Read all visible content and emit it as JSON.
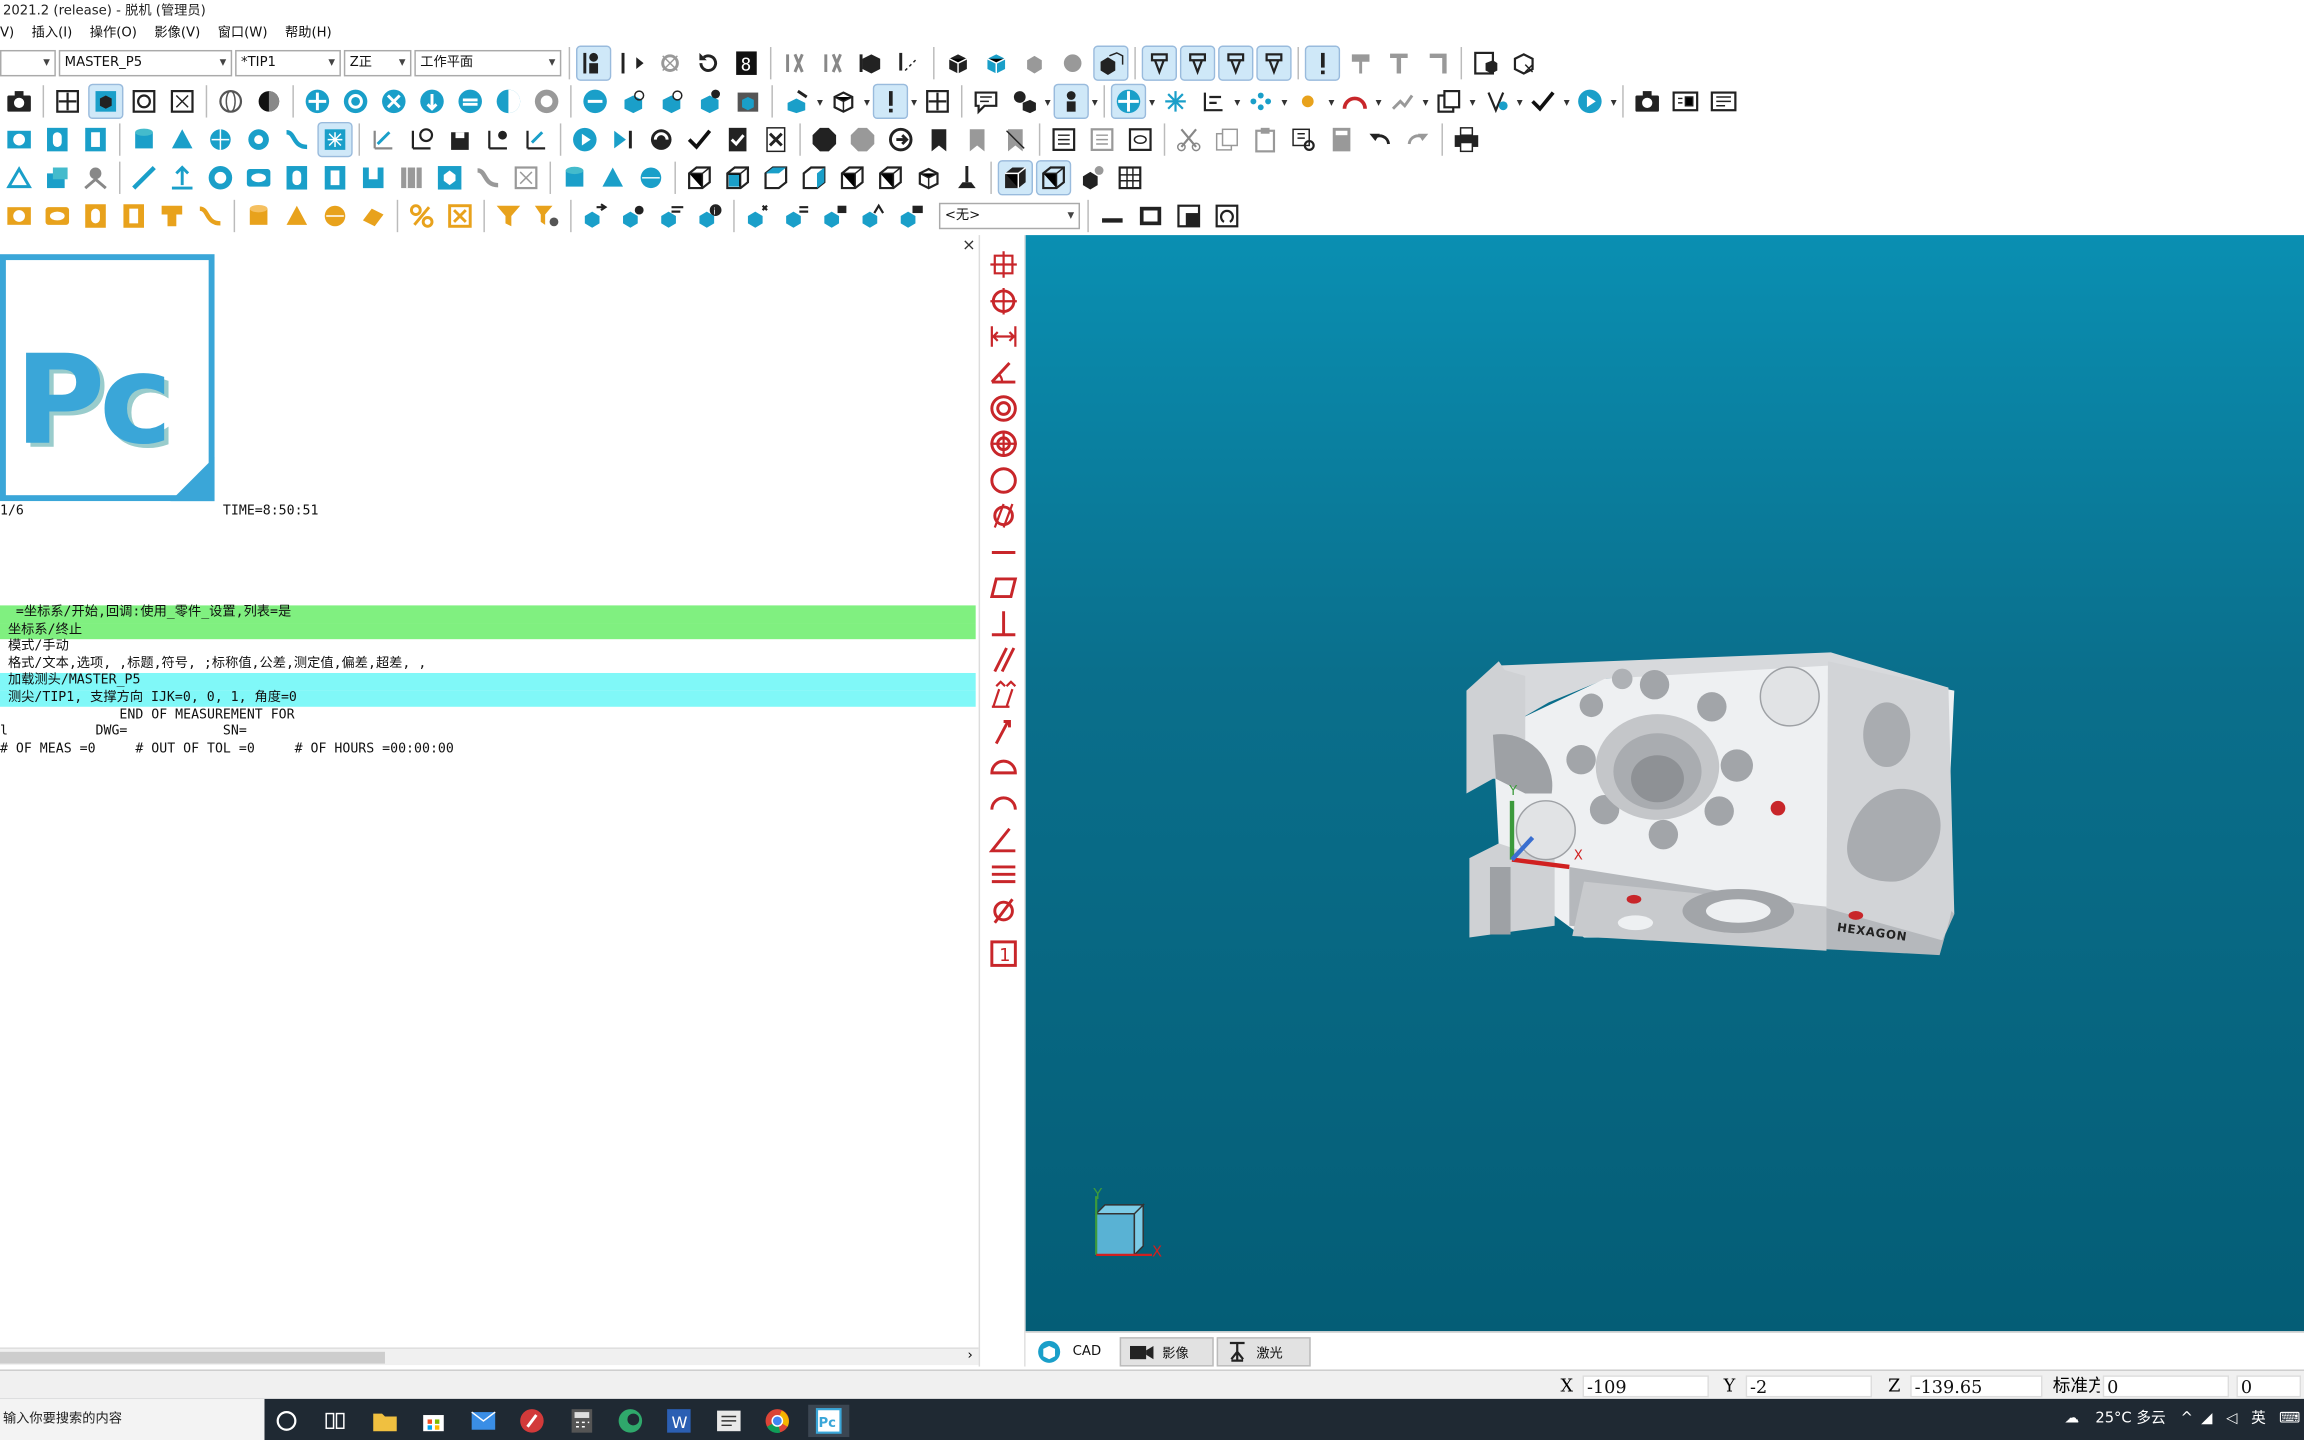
{
  "window": {
    "title": "2021.2 (release) - 脱机 (管理员)"
  },
  "menu": [
    "V)",
    "插入(I)",
    "操作(O)",
    "影像(V)",
    "窗口(W)",
    "帮助(H)"
  ],
  "toolbar": {
    "dd_first": "",
    "dd_alignment": "MASTER_P5",
    "dd_tip": "*TIP1",
    "dd_view": "Z正",
    "dd_workplane": "工作平面",
    "dd_none": "<无>"
  },
  "editor": {
    "logo_text": "Pc",
    "lines": [
      {
        "text": "1/6                         TIME=8:50:51",
        "hl": ""
      },
      {
        "text": "  =坐标系/开始,回调:使用_零件_设置,列表=是",
        "hl": "green"
      },
      {
        "text": " 坐标系/终止",
        "hl": "green"
      },
      {
        "text": " 模式/手动",
        "hl": ""
      },
      {
        "text": " 格式/文本,选项, ,标题,符号, ;标称值,公差,测定值,偏差,超差, ,",
        "hl": ""
      },
      {
        "text": " 加载测头/MASTER_P5",
        "hl": "cyan"
      },
      {
        "text": " 测尖/TIP1, 支撑方向 IJK=0, 0, 1, 角度=0",
        "hl": "cyan"
      },
      {
        "text": "               END OF MEASUREMENT FOR",
        "hl": ""
      },
      {
        "text": "l           DWG=            SN=",
        "hl": ""
      },
      {
        "text": "# OF MEAS =0     # OUT OF TOL =0     # OF HOURS =00:00:00",
        "hl": ""
      }
    ],
    "close": "×"
  },
  "viewport": {
    "brand_text": "HEXAGON",
    "axis_x": "X",
    "axis_y": "Y",
    "tabs": [
      {
        "label": "CAD",
        "icon": "cube-icon"
      },
      {
        "label": "影像",
        "icon": "video-camera-icon"
      },
      {
        "label": "激光",
        "icon": "laser-icon"
      }
    ]
  },
  "status": {
    "x_label": "X",
    "x_value": "-109",
    "y_label": "Y",
    "y_value": "-2",
    "z_label": "Z",
    "z_value": "-139.65",
    "mode_label": "标准方",
    "mode_value": "0",
    "count_value": "0"
  },
  "taskbar": {
    "search_placeholder": "输入你要搜索的内容",
    "weather": "25°C 多云",
    "lang": "英"
  },
  "colors": {
    "teal": "#1a9fc9",
    "orange": "#e8a21c",
    "red_tool": "#c8262a",
    "viewport": "#0a7fa0"
  }
}
